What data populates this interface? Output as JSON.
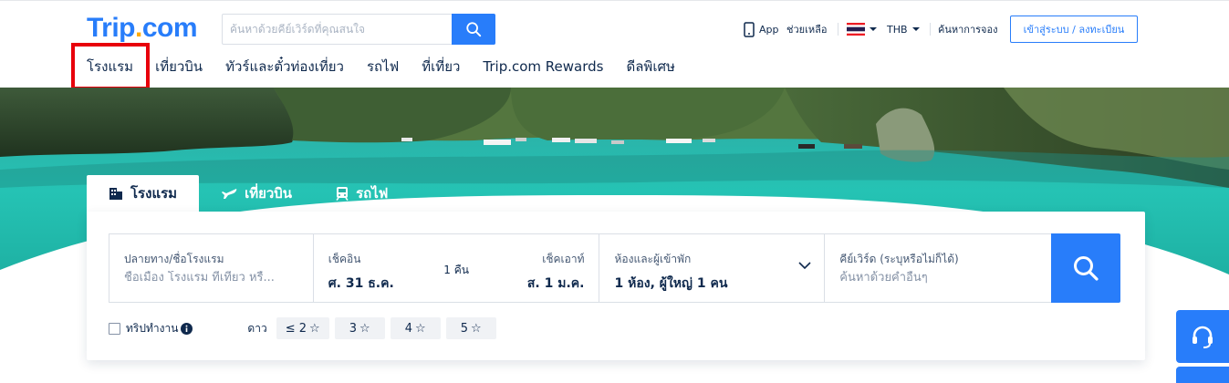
{
  "header": {
    "logo_text": "Trip",
    "logo_dot": ".",
    "logo_suffix": "com",
    "search_placeholder": "ค้นหาด้วยคีย์เวิร์ดที่คุณสนใจ",
    "app_label": "App",
    "help_label": "ช่วยเหลือ",
    "currency": "THB",
    "bookings_label": "ค้นหาการจอง",
    "login_label": "เข้าสู่ระบบ / ลงทะเบียน"
  },
  "nav": {
    "items": [
      "โรงแรม",
      "เที่ยวบิน",
      "ทัวร์และตั๋วท่องเที่ยว",
      "รถไฟ",
      "ที่เที่ยว",
      "Trip.com Rewards",
      "ดีลพิเศษ"
    ]
  },
  "tabs": [
    {
      "label": "โรงแรม",
      "icon": "hotel-icon",
      "active": true
    },
    {
      "label": "เที่ยวบิน",
      "icon": "plane-icon",
      "active": false
    },
    {
      "label": "รถไฟ",
      "icon": "train-icon",
      "active": false
    }
  ],
  "search": {
    "destination_label": "ปลายทาง/ชื่อโรงแรม",
    "destination_placeholder": "ชื่อเมือง โรงแรม ที่เที่ยว หรื...",
    "checkin_label": "เช็คอิน",
    "checkin_value": "ศ. 31 ธ.ค.",
    "nights": "1 คืน",
    "checkout_label": "เช็คเอาท์",
    "checkout_value": "ส. 1 ม.ค.",
    "rooms_label": "ห้องและผู้เข้าพัก",
    "rooms_value": "1 ห้อง, ผู้ใหญ่ 1 คน",
    "keyword_label": "คีย์เวิร์ด (ระบุหรือไม่ก็ได้)",
    "keyword_placeholder": "ค้นหาด้วยคำอื่นๆ"
  },
  "options": {
    "business_trip_label": "ทริปทำงาน",
    "stars_label": "ดาว",
    "star_filters": [
      "≤ 2",
      "3",
      "4",
      "5"
    ]
  },
  "colors": {
    "brand_blue": "#287dfa",
    "logo_dot": "#ffaa00",
    "highlight_red": "#e8000b",
    "text_dark": "#0f294d"
  }
}
